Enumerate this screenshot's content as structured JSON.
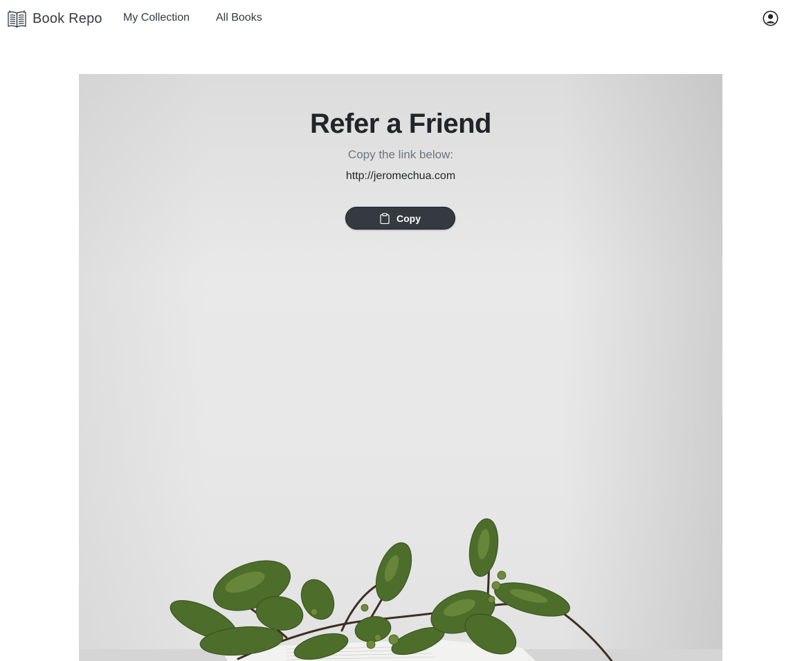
{
  "navbar": {
    "brand_label": "Book Repo",
    "links": [
      {
        "label": "My Collection"
      },
      {
        "label": "All Books"
      }
    ],
    "profile_icon": "user-circle-icon"
  },
  "hero": {
    "title": "Refer a Friend",
    "subtitle": "Copy the link below:",
    "link": "http://jeromechua.com",
    "copy_button": {
      "label": "Copy",
      "icon": "clipboard-icon"
    },
    "background_image": "plant-branch-on-book"
  },
  "colors": {
    "button_bg": "#343a40",
    "text_dark": "#212529",
    "text_muted": "#6c757d",
    "leaf_green": "#4a6b2a"
  }
}
